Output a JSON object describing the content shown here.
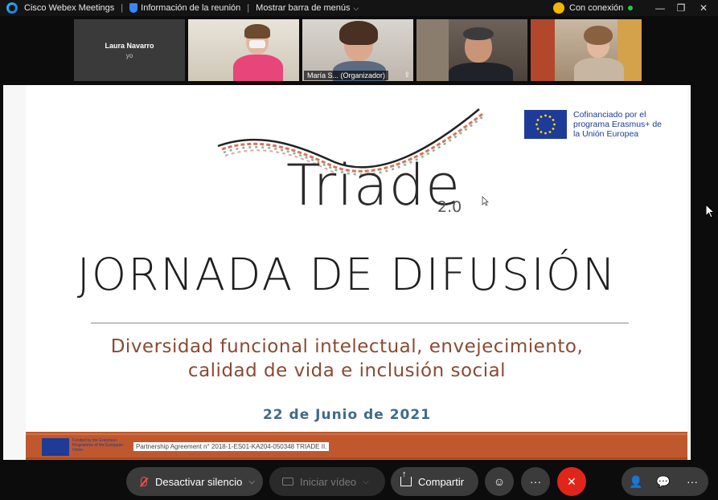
{
  "titlebar": {
    "app_name": "Cisco Webex Meetings",
    "meeting_info": "Información de la reunión",
    "show_menu": "Mostrar barra de menús",
    "connection_status": "Con conexión"
  },
  "participants": [
    {
      "name": "Laura Navarro",
      "sub": "yo"
    },
    {
      "name": ""
    },
    {
      "name": "María S...  (Organizador)",
      "sub": ""
    },
    {
      "name": ""
    },
    {
      "name": ""
    }
  ],
  "slide": {
    "eu_text": "Cofinanciado por el programa Erasmus+ de la Unión Europea",
    "logo_word": "Triade",
    "logo_version": "2.0",
    "title": "JORNADA DE DIFUSIÓN",
    "subtitle_line1": "Diversidad funcional intelectual, envejecimiento,",
    "subtitle_line2": "calidad de vida e inclusión social",
    "date": "22 de Junio de 2021",
    "footer_funded": "Funded by the Erasmus+ Programme of the European Union",
    "footer_agreement": "Partnership Agreement n° 2018-1-ES01-KA204-050348 TRIADE II."
  },
  "toolbar": {
    "unmute_label": "Desactivar silencio",
    "video_label": "Iniciar vídeo",
    "share_label": "Compartir",
    "more_label": "···",
    "end_label": "✕",
    "participants_icon": "participants-icon",
    "chat_icon": "chat-icon",
    "more_right_label": "···"
  },
  "colors": {
    "accent_blue": "#3aa0ff",
    "end_red": "#e0261b",
    "eu_blue": "#1d3b97",
    "subtitle_brown": "#8b4a32",
    "date_blue": "#3f6a8d",
    "footer_orange": "#c0582e"
  }
}
